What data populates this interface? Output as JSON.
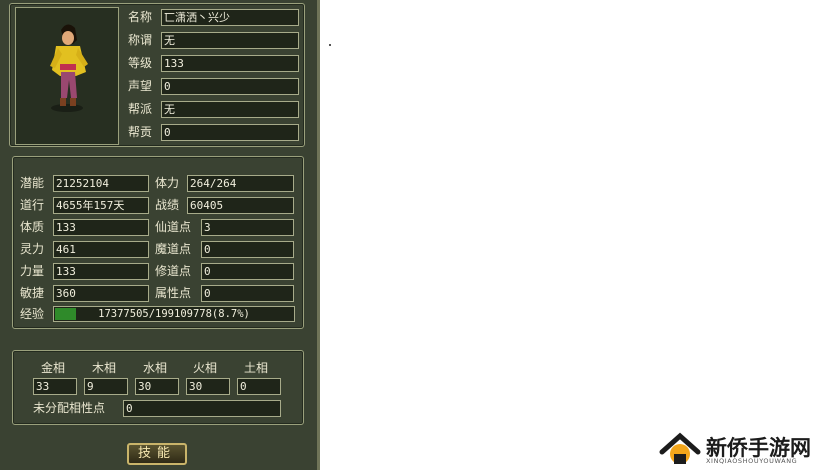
{
  "profile": {
    "name_label": "名称",
    "name_value": "匸潇洒丶兴少",
    "title_label": "称谓",
    "title_value": "无",
    "level_label": "等级",
    "level_value": "133",
    "fame_label": "声望",
    "fame_value": "0",
    "guild_label": "帮派",
    "guild_value": "无",
    "contrib_label": "帮贡",
    "contrib_value": "0"
  },
  "stats": {
    "potential_label": "潜能",
    "potential_value": "21252104",
    "stamina_label": "体力",
    "stamina_value": "264/264",
    "dao_label": "道行",
    "dao_value": "4655年157天",
    "merit_label": "战绩",
    "merit_value": "60405",
    "con_label": "体质",
    "con_value": "133",
    "immortal_label": "仙道点",
    "immortal_value": "3",
    "spirit_label": "灵力",
    "spirit_value": "461",
    "demon_label": "魔道点",
    "demon_value": "0",
    "str_label": "力量",
    "str_value": "133",
    "cultivate_label": "修道点",
    "cultivate_value": "0",
    "agi_label": "敏捷",
    "agi_value": "360",
    "attr_label": "属性点",
    "attr_value": "0"
  },
  "exp": {
    "label": "经验",
    "text": "17377505/199109778(8.7%)",
    "fraction": 0.087
  },
  "elements": {
    "metal_label": "金相",
    "metal_value": "33",
    "wood_label": "木相",
    "wood_value": "9",
    "water_label": "水相",
    "water_value": "30",
    "fire_label": "火相",
    "fire_value": "30",
    "earth_label": "土相",
    "earth_value": "0",
    "unalloc_label": "未分配相性点",
    "unalloc_value": "0"
  },
  "buttons": {
    "skills": "技能"
  },
  "watermark": {
    "name": "新侨手游网",
    "sub": "XINQIAOSHOUYOUWANG"
  },
  "colors": {
    "panel_bg": "#3a4232",
    "exp_fill": "#2f8a2a",
    "text": "#e9e6cf"
  }
}
